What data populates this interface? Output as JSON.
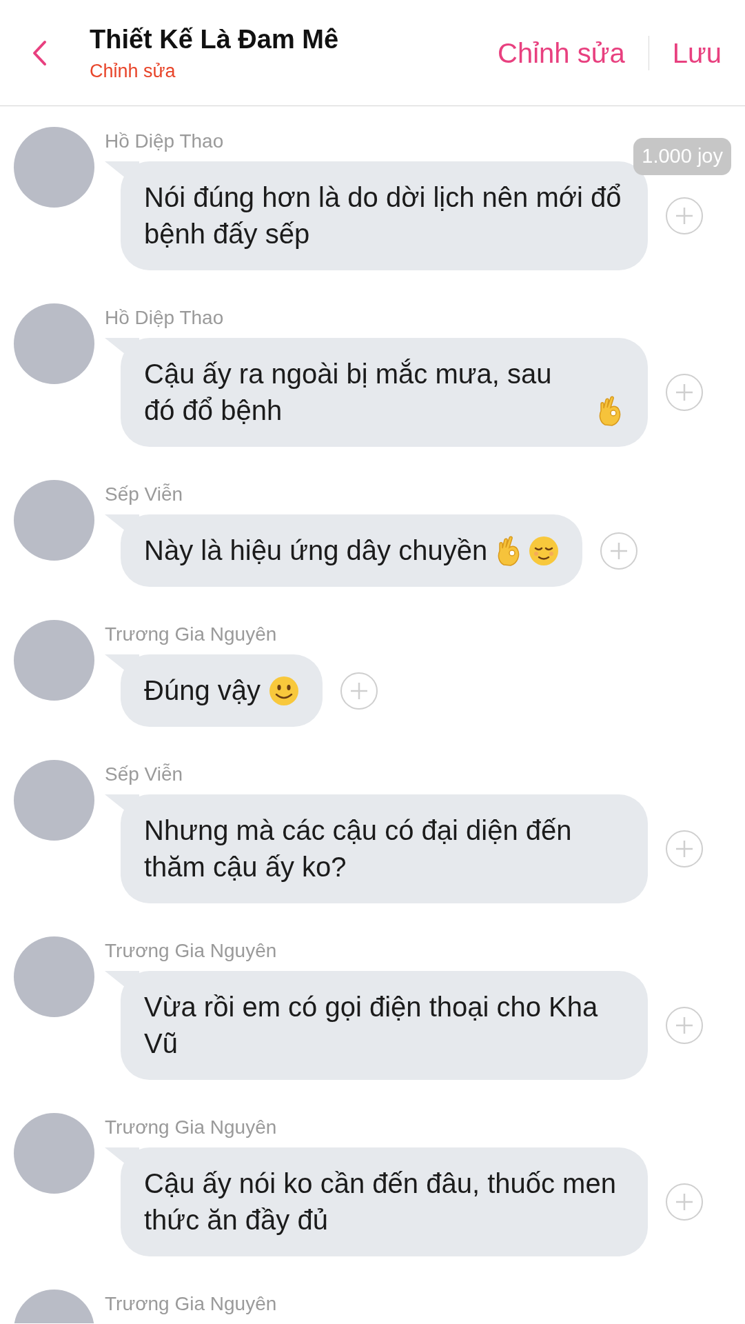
{
  "header": {
    "title": "Thiết Kế Là Đam Mê",
    "subtitle": "Chỉnh sửa",
    "actions": [
      "Chỉnh sửa",
      "Lưu"
    ]
  },
  "messages": [
    {
      "sender": "Hồ Diệp Thao",
      "text": "Nói đúng hơn là do dời lịch nên mới đổ bệnh đấy sếp",
      "badge": "1.000 joy"
    },
    {
      "sender": "Hồ Diệp Thao",
      "text": "Cậu ấy ra ngoài bị mắc mưa, sau đó đổ bệnh",
      "emojis": [
        {
          "kind": "ok"
        }
      ]
    },
    {
      "sender": "Sếp Viễn",
      "text": "Này là hiệu ứng dây chuyền",
      "emojis": [
        {
          "kind": "ok"
        },
        {
          "kind": "relieved"
        }
      ]
    },
    {
      "sender": "Trương Gia Nguyên",
      "text": "Đúng vậy",
      "emojis": [
        {
          "kind": "smile"
        }
      ]
    },
    {
      "sender": "Sếp Viễn",
      "text": "Nhưng mà các cậu có đại diện đến thăm cậu ấy ko?"
    },
    {
      "sender": "Trương Gia Nguyên",
      "text": "Vừa rồi em có gọi điện thoại cho Kha Vũ"
    },
    {
      "sender": "Trương Gia Nguyên",
      "text": "Cậu ấy nói ko cần đến đâu, thuốc men thức ăn đầy đủ"
    },
    {
      "sender": "Trương Gia Nguyên"
    }
  ]
}
